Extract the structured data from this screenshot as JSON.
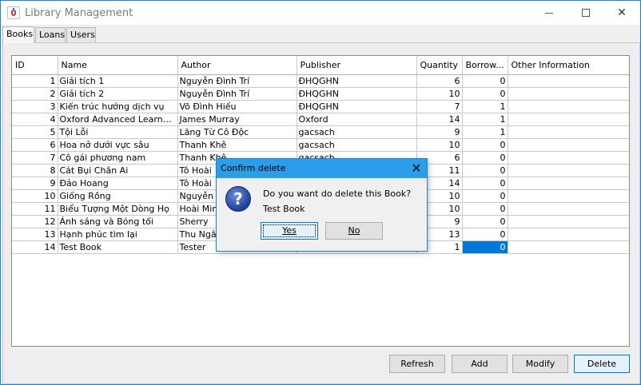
{
  "window": {
    "title": "Library Management"
  },
  "tabs": [
    "Books",
    "Loans",
    "Users"
  ],
  "table": {
    "columns": [
      "ID",
      "Name",
      "Author",
      "Publisher",
      "Quantity",
      "Borrow...",
      "Other Information"
    ],
    "rows": [
      [
        "1",
        "Giải tích 1",
        "Nguyễn Đình Trí",
        "ĐHQGHN",
        "6",
        "0",
        ""
      ],
      [
        "2",
        "Giải tích 2",
        "Nguyễn Đình Trí",
        "ĐHQGHN",
        "10",
        "0",
        ""
      ],
      [
        "3",
        "Kiến trúc hướng dịch vụ",
        "Võ Đình Hiếu",
        "ĐHQGHN",
        "7",
        "1",
        ""
      ],
      [
        "4",
        "Oxford Advanced Learner's ...",
        "James Murray",
        "Oxford",
        "14",
        "1",
        ""
      ],
      [
        "5",
        "Tội Lỗi",
        "Lăng Từ Cô Độc",
        "gacsach",
        "9",
        "1",
        ""
      ],
      [
        "6",
        "Hoa nở dưới vực sâu",
        "Thanh Khê",
        "gacsach",
        "10",
        "0",
        ""
      ],
      [
        "7",
        "Cô gái phương nam",
        "Thanh Khê",
        "gacsach",
        "6",
        "0",
        ""
      ],
      [
        "8",
        "Cát Bụi Chân Ai",
        "Tô Hoài",
        "",
        "11",
        "0",
        ""
      ],
      [
        "9",
        "Đảo Hoang",
        "Tô Hoài",
        "",
        "14",
        "0",
        ""
      ],
      [
        "10",
        "Giống Rồng",
        "Nguyễn K",
        "",
        "10",
        "0",
        ""
      ],
      [
        "11",
        "Biểu Tượng Một Dòng Họ",
        "Hoài Minh",
        "",
        "10",
        "0",
        ""
      ],
      [
        "12",
        "Ánh sáng và Bóng tối",
        "Sherry",
        "",
        "9",
        "0",
        ""
      ],
      [
        "13",
        "Hạnh phúc tìm lại",
        "Thu Ngân",
        "",
        "13",
        "0",
        ""
      ],
      [
        "14",
        "Test Book",
        "Tester",
        "",
        "1",
        "0",
        ""
      ]
    ]
  },
  "buttons": {
    "refresh": "Refresh",
    "add": "Add",
    "modify": "Modify",
    "delete": "Delete"
  },
  "dialog": {
    "title": "Confirm delete",
    "message": "Do you want do delete this Book?",
    "item": "Test Book",
    "yes": "Yes",
    "no": "No"
  },
  "colors": {
    "selection": "#0078d7",
    "dialog_title_bar": "#2a9ee8",
    "window_border": "#1883d7"
  }
}
